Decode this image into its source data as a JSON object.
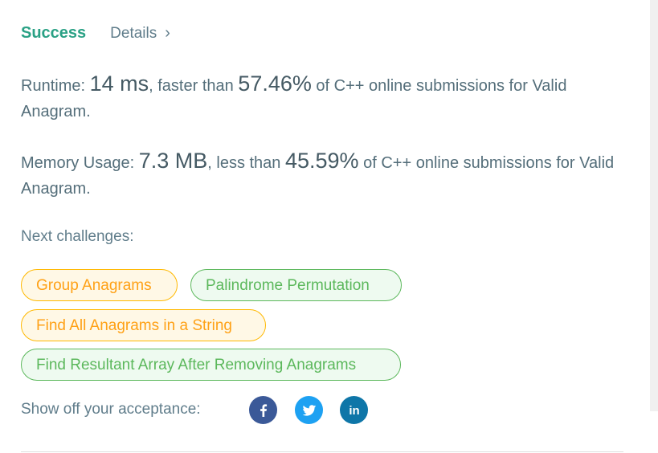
{
  "header": {
    "status": "Success",
    "details_label": "Details",
    "chevron": "›"
  },
  "runtime": {
    "label": "Runtime: ",
    "value": "14 ms",
    "comparison": ", faster than ",
    "percent": "57.46%",
    "suffix": " of C++ online submissions for Valid Anagram."
  },
  "memory": {
    "label": "Memory Usage: ",
    "value": "7.3 MB",
    "comparison": ", less than ",
    "percent": "45.59%",
    "suffix": " of C++ online submissions for Valid Anagram."
  },
  "next_challenges": {
    "label": "Next challenges:",
    "items": [
      {
        "label": "Group Anagrams",
        "difficulty": "medium"
      },
      {
        "label": "Palindrome Permutation",
        "difficulty": "easy"
      },
      {
        "label": "Find All Anagrams in a String",
        "difficulty": "medium"
      },
      {
        "label": "Find Resultant Array After Removing Anagrams",
        "difficulty": "easy"
      }
    ]
  },
  "share": {
    "label": "Show off your acceptance:",
    "icons": [
      "facebook-icon",
      "twitter-icon",
      "linkedin-icon"
    ],
    "linkedin_text": "in"
  },
  "colors": {
    "success": "#2aa185",
    "medium": "#ffa116",
    "easy": "#5cb85c",
    "facebook": "#3b5998",
    "twitter": "#1da1f2",
    "linkedin": "#0e76a8"
  }
}
